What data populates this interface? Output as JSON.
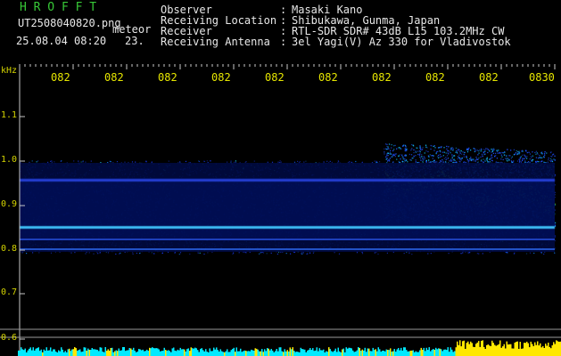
{
  "header": {
    "brand": "H R O F F T",
    "filename": "UT2508040820.png",
    "tag": "meteor",
    "datetime": "25.08.04 08:20",
    "count": "23."
  },
  "info": {
    "labels": [
      "Observer",
      "Receiving Location",
      "Receiver",
      "Receiving Antenna"
    ],
    "separators": [
      ":",
      ":",
      ":",
      ":"
    ],
    "values": [
      "Masaki Kano",
      "Shibukawa, Gunma, Japan",
      "RTL-SDR SDR# 43dB L15 103.2MHz CW",
      "3el Yagi(V) Az 330 for Vladivostok"
    ]
  },
  "time_axis": {
    "labels": [
      "082",
      "082",
      "082",
      "082",
      "082",
      "082",
      "082",
      "082",
      "082",
      "0830"
    ]
  },
  "freq_axis": {
    "unit": "kHz",
    "ticks": [
      "1.1",
      "1.0",
      "0.9",
      "0.8",
      "0.7",
      "0.6"
    ]
  },
  "colors": {
    "background": "#000000",
    "brand": "#37c837",
    "header_text": "#e8e8e8",
    "time_labels": "#e6e600",
    "freq_labels": "#d4d400",
    "signal_weak": "#1030ff",
    "signal_mid": "#00ddff",
    "signal_strong": "#90ff30",
    "bottom_bar_cyan": "#00eaff",
    "bottom_bar_yellow": "#ffe800"
  }
}
